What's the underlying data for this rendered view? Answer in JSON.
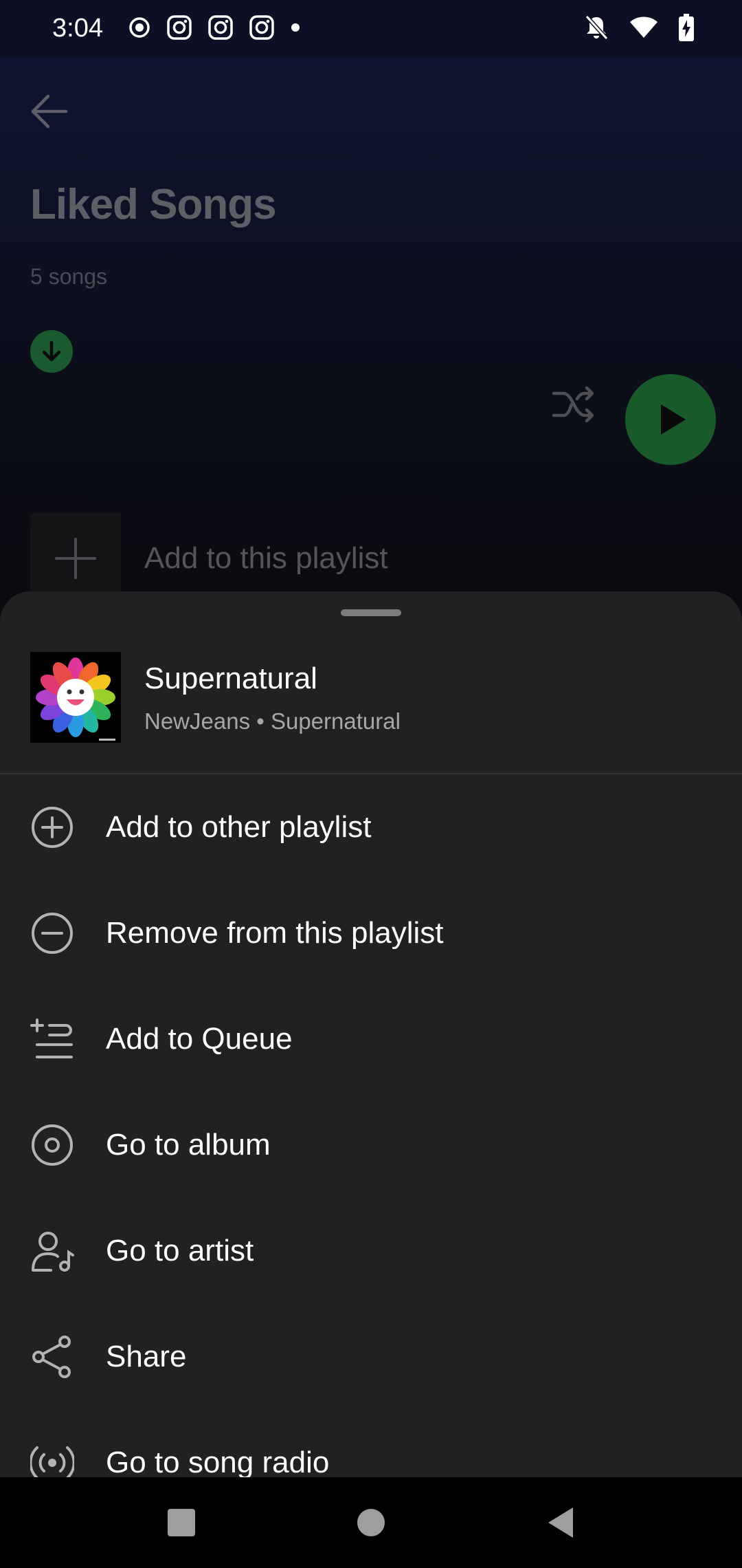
{
  "status_bar": {
    "time": "3:04",
    "left_icons": [
      "record-icon",
      "instagram-icon",
      "instagram-icon",
      "instagram-icon",
      "dot-icon"
    ],
    "right_icons": [
      "bell-off-icon",
      "wifi-icon",
      "battery-charging-icon"
    ]
  },
  "background_page": {
    "title": "Liked Songs",
    "song_count": "5 songs",
    "add_label": "Add to this playlist",
    "accent_color": "#1db954"
  },
  "sheet": {
    "song": {
      "title": "Supernatural",
      "subtitle": "NewJeans • Supernatural"
    },
    "menu": [
      {
        "label": "Add to other playlist",
        "icon": "plus-circle-icon"
      },
      {
        "label": "Remove from this playlist",
        "icon": "minus-circle-icon"
      },
      {
        "label": "Add to Queue",
        "icon": "add-queue-icon"
      },
      {
        "label": "Go to album",
        "icon": "album-icon"
      },
      {
        "label": "Go to artist",
        "icon": "artist-icon"
      },
      {
        "label": "Share",
        "icon": "share-icon"
      },
      {
        "label": "Go to song radio",
        "icon": "radio-icon"
      }
    ]
  },
  "nav_bar": {
    "buttons": [
      "recents-button",
      "home-button",
      "back-button"
    ]
  }
}
